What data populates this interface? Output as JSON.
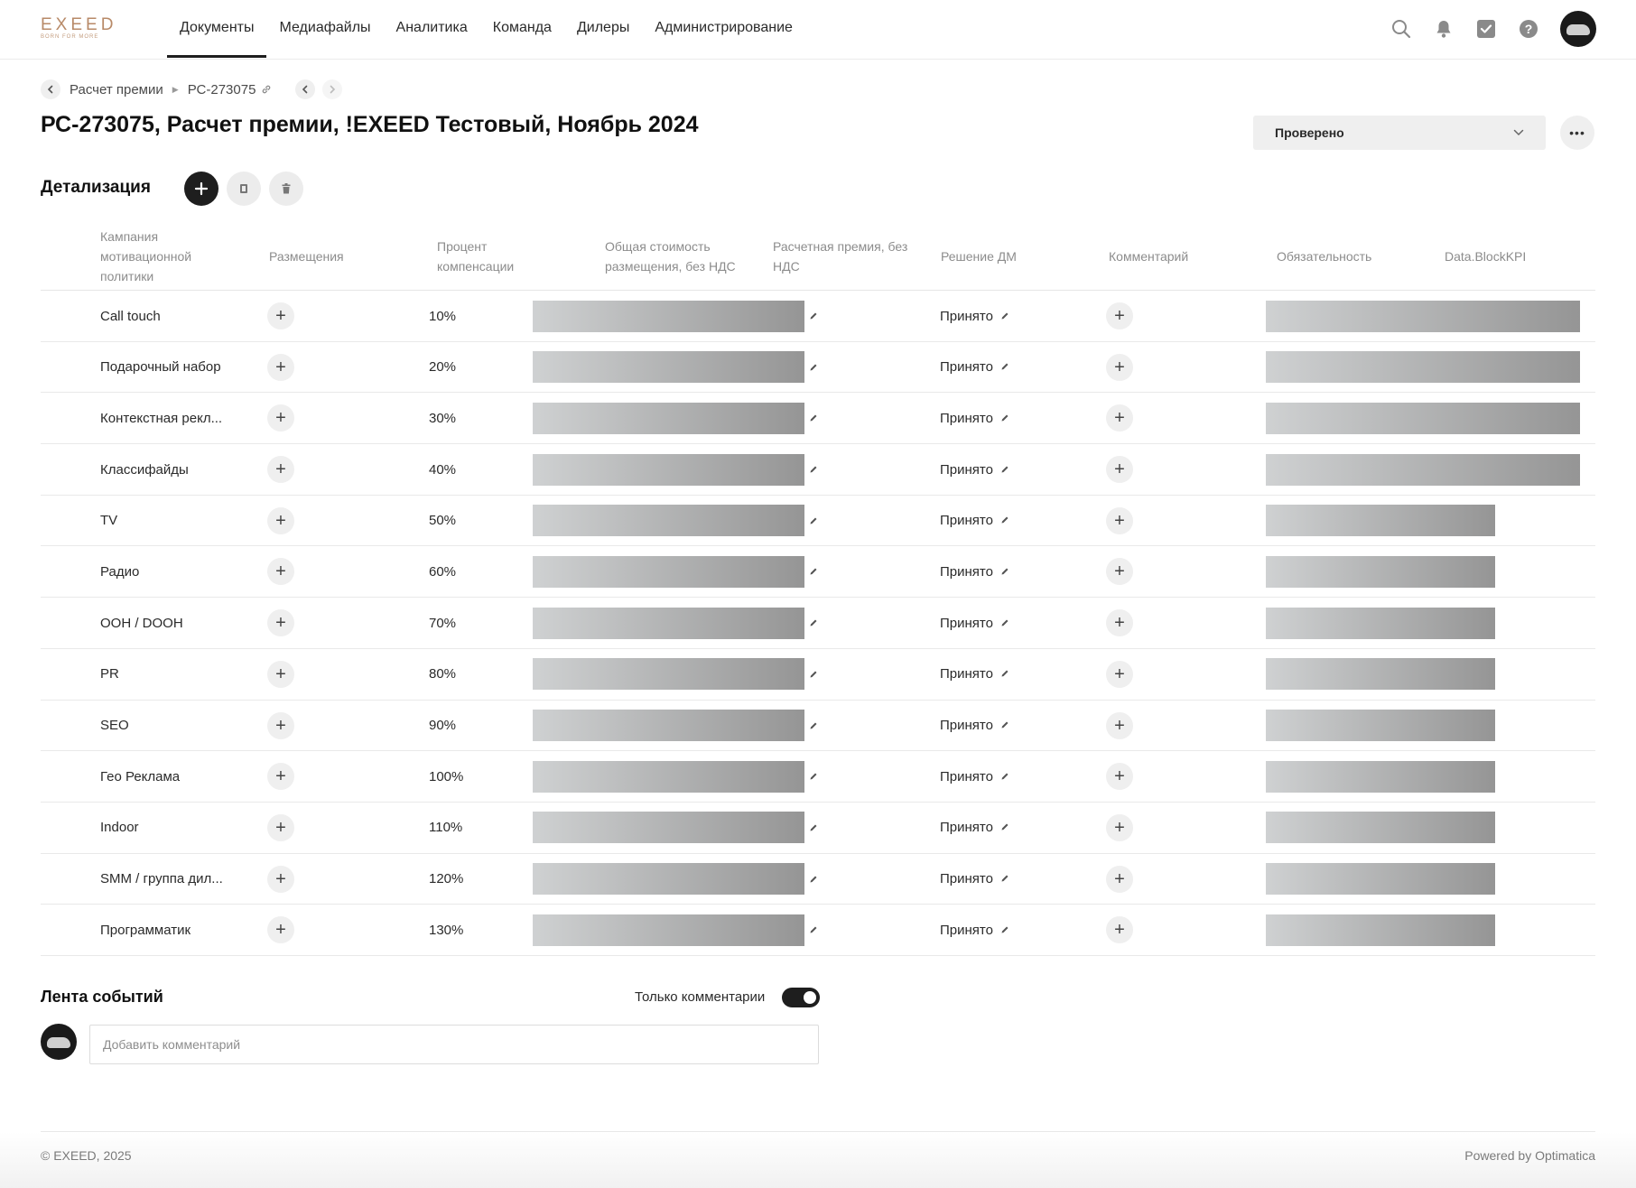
{
  "header": {
    "logo_text": "EXEED",
    "logo_tagline": "BORN FOR MORE",
    "nav": [
      {
        "label": "Документы"
      },
      {
        "label": "Медиафайлы"
      },
      {
        "label": "Аналитика"
      },
      {
        "label": "Команда"
      },
      {
        "label": "Дилеры"
      },
      {
        "label": "Администрирование"
      }
    ],
    "active_nav": "Документы",
    "icons": [
      "search-icon",
      "bell-icon",
      "tasks-check-icon",
      "help-icon",
      "user-avatar"
    ]
  },
  "breadcrumbs": {
    "parent": "Расчет премии",
    "current": "РС-273075"
  },
  "page": {
    "title": "РС-273075, Расчет премии, !EXEED Тестовый, Ноябрь 2024",
    "status": "Проверено"
  },
  "details": {
    "title": "Детализация",
    "columns": [
      "Кампания мотивационной политики",
      "Размещения",
      "Процент компенсации",
      "Общая стоимость размещения, без НДС",
      "Расчетная премия, без НДС",
      "Решение ДМ",
      "Комментарий",
      "Обязательность",
      "Data.BlockKPI"
    ],
    "rows": [
      {
        "campaign": "Call touch",
        "percent": "10%",
        "decision": "Принято"
      },
      {
        "campaign": "Подарочный набор",
        "percent": "20%",
        "decision": "Принято"
      },
      {
        "campaign": "Контекстная рекл...",
        "percent": "30%",
        "decision": "Принято"
      },
      {
        "campaign": "Классифайды",
        "percent": "40%",
        "decision": "Принято"
      },
      {
        "campaign": "TV",
        "percent": "50%",
        "decision": "Принято"
      },
      {
        "campaign": "Радио",
        "percent": "60%",
        "decision": "Принято"
      },
      {
        "campaign": "OOH / DOOH",
        "percent": "70%",
        "decision": "Принято"
      },
      {
        "campaign": "PR",
        "percent": "80%",
        "decision": "Принято"
      },
      {
        "campaign": "SEO",
        "percent": "90%",
        "decision": "Принято"
      },
      {
        "campaign": "Гео Реклама",
        "percent": "100%",
        "decision": "Принято"
      },
      {
        "campaign": "Indoor",
        "percent": "110%",
        "decision": "Принято"
      },
      {
        "campaign": "SMM / группа дил...",
        "percent": "120%",
        "decision": "Принято"
      },
      {
        "campaign": "Программатик",
        "percent": "130%",
        "decision": "Принято"
      }
    ]
  },
  "feed": {
    "title": "Лента событий",
    "toggle_label": "Только комментарии",
    "toggle_on": true,
    "comment_placeholder": "Добавить комментарий"
  },
  "footer": {
    "copyright": "© EXEED, 2025",
    "powered": "Powered by Optimatica"
  },
  "colors": {
    "primary_dark": "#1e1e1e",
    "brand_gold": "#b88a68",
    "muted_bg": "#efefef"
  }
}
